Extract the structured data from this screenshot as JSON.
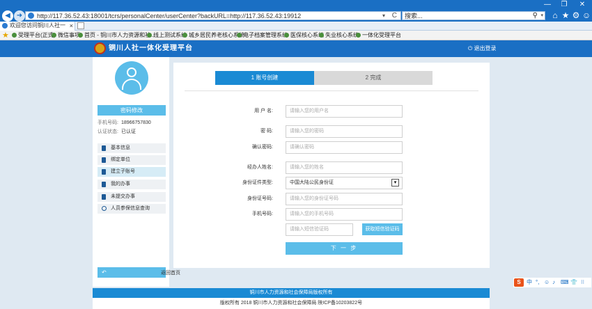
{
  "browser": {
    "window_buttons": [
      "—",
      "❐",
      "✕"
    ],
    "back": "◀",
    "forward": "➜",
    "address": "http://117.36.52.43:18001/tcrs/personalCenter/userCenter?backURL=http://117.36.52.43:19912",
    "address_dropdown": "▾",
    "refresh": "C",
    "search_text": "搜索...",
    "search_icon": "⚲",
    "toolbar_icons": [
      "⌂",
      "★",
      "⚙",
      "☺"
    ],
    "tab_label": "欢迎您访问铜川人社一体化...",
    "tab_close": "×"
  },
  "favorites": [
    "受理平台(正式)",
    "微信事项",
    "首页 - 铜川市人力资源和社...",
    "线上测试系统",
    "城乡居民养老核心系统",
    "电子档案管理系统",
    "医保核心系统",
    "失业核心系统",
    "一体化受理平台"
  ],
  "site": {
    "title": "铜川人社一体化受理平台",
    "logout": "⏻ 退出登录"
  },
  "left": {
    "change_password": "密码修改",
    "phone_label": "手机号码:",
    "phone_value": "18966757830",
    "auth_label": "认证状态:",
    "auth_value": "已认证",
    "menu": [
      "基本信息",
      "绑定单位",
      "建立子账号",
      "我的办事",
      "未提交办事",
      "人员参保信息查询"
    ],
    "back_home": "返回首页",
    "back_home_icon": "↶"
  },
  "steps": {
    "step1": "1 账号创建",
    "step2": "2 完成"
  },
  "form": {
    "username_label": "用  户  名:",
    "username_ph": "请输入您的用户名",
    "password_label": "密      码:",
    "password_ph": "请输入您的密码",
    "confirm_label": "确认密码:",
    "confirm_ph": "请确认密码",
    "name_label": "经办人姓名:",
    "name_ph": "请输入您的姓名",
    "idtype_label": "身份证件类型:",
    "idtype_value": "中国大陆公民身份证",
    "idtype_arrow": "▾",
    "idno_label": "身份证号码:",
    "idno_ph": "请输入您的身份证号码",
    "mobile_label": "手机号码:",
    "mobile_ph": "请输入您的手机号码",
    "sms_ph": "请输入短信验证码",
    "get_code": "获取短信验证码",
    "next": "下 一 步"
  },
  "footer": {
    "org": "铜川市人力资源和社会保障局版权所有",
    "copyright": "版权所有 2018 铜川市人力资源和社会保障局 陕ICP备10203822号"
  },
  "ime": {
    "logo": "S",
    "items": [
      "中",
      "°,",
      "☺",
      "♪",
      "⌨",
      "👕",
      "⁝⁝"
    ]
  }
}
